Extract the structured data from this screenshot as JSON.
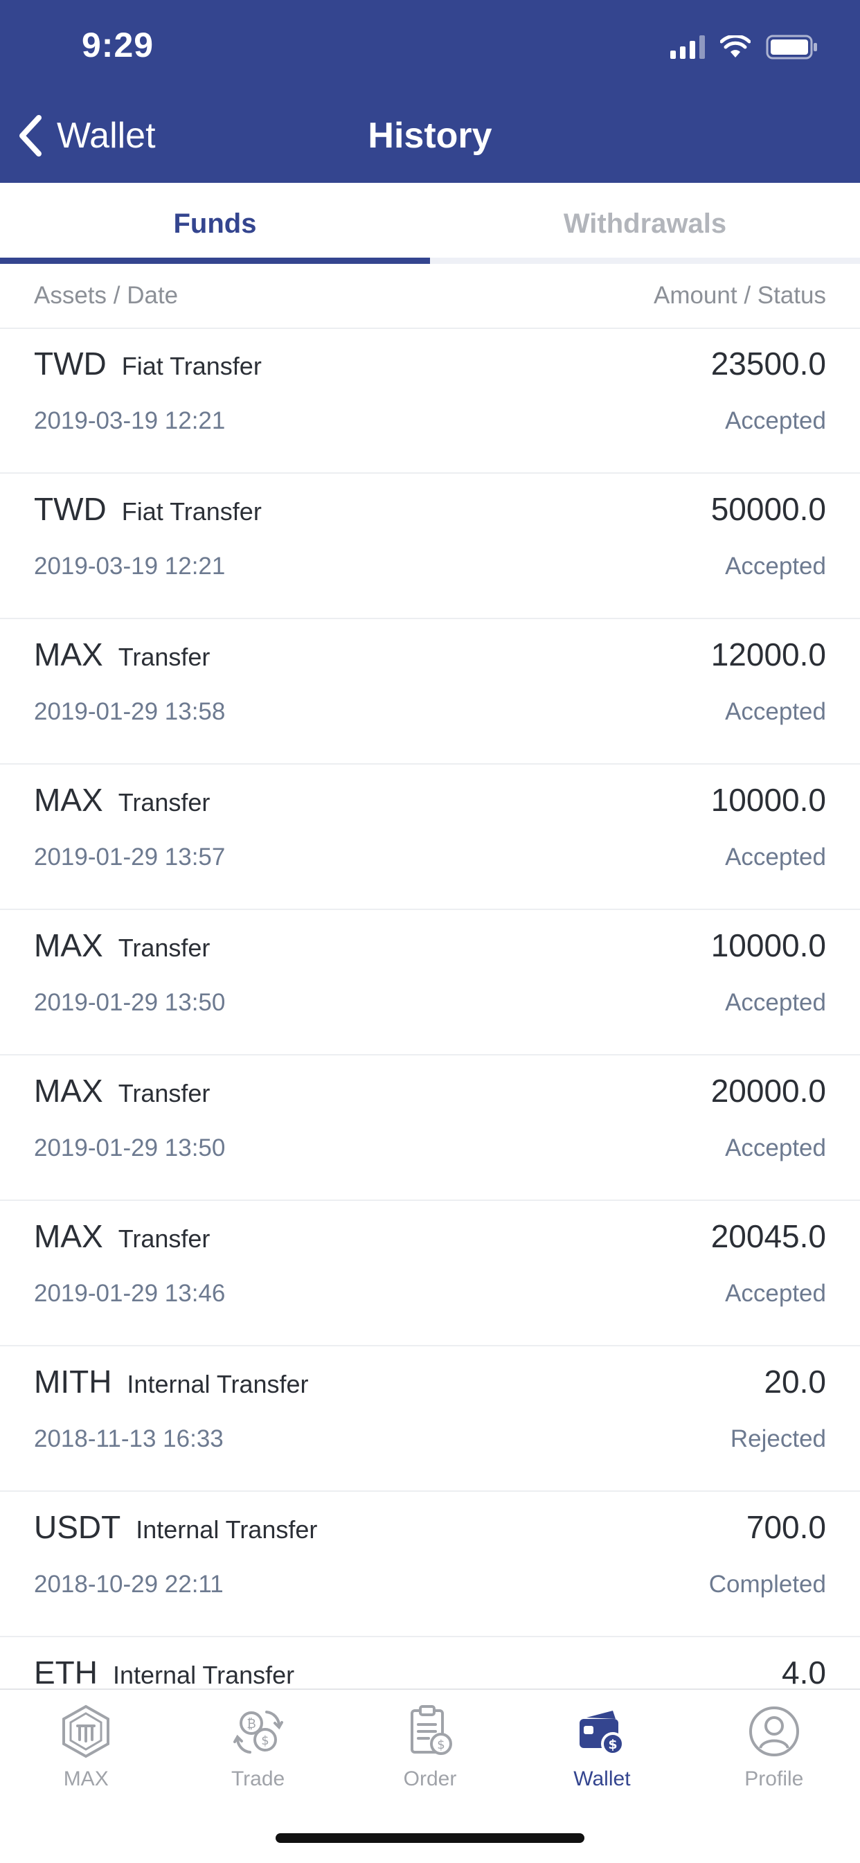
{
  "status_bar": {
    "time": "9:29"
  },
  "nav": {
    "back_label": "Wallet",
    "title": "History"
  },
  "tabs": [
    {
      "label": "Funds",
      "active": true
    },
    {
      "label": "Withdrawals",
      "active": false
    }
  ],
  "columns": {
    "left": "Assets / Date",
    "right": "Amount / Status"
  },
  "records": [
    {
      "asset": "TWD",
      "kind": "Fiat Transfer",
      "date": "2019-03-19 12:21",
      "amount": "23500.0",
      "status": "Accepted"
    },
    {
      "asset": "TWD",
      "kind": "Fiat Transfer",
      "date": "2019-03-19 12:21",
      "amount": "50000.0",
      "status": "Accepted"
    },
    {
      "asset": "MAX",
      "kind": "Transfer",
      "date": "2019-01-29 13:58",
      "amount": "12000.0",
      "status": "Accepted"
    },
    {
      "asset": "MAX",
      "kind": "Transfer",
      "date": "2019-01-29 13:57",
      "amount": "10000.0",
      "status": "Accepted"
    },
    {
      "asset": "MAX",
      "kind": "Transfer",
      "date": "2019-01-29 13:50",
      "amount": "10000.0",
      "status": "Accepted"
    },
    {
      "asset": "MAX",
      "kind": "Transfer",
      "date": "2019-01-29 13:50",
      "amount": "20000.0",
      "status": "Accepted"
    },
    {
      "asset": "MAX",
      "kind": "Transfer",
      "date": "2019-01-29 13:46",
      "amount": "20045.0",
      "status": "Accepted"
    },
    {
      "asset": "MITH",
      "kind": "Internal Transfer",
      "date": "2018-11-13 16:33",
      "amount": "20.0",
      "status": "Rejected"
    },
    {
      "asset": "USDT",
      "kind": "Internal Transfer",
      "date": "2018-10-29 22:11",
      "amount": "700.0",
      "status": "Completed"
    },
    {
      "asset": "ETH",
      "kind": "Internal Transfer",
      "date": "",
      "amount": "4.0",
      "status": ""
    }
  ],
  "tabbar": [
    {
      "label": "MAX",
      "icon": "max-logo-icon",
      "active": false
    },
    {
      "label": "Trade",
      "icon": "trade-icon",
      "active": false
    },
    {
      "label": "Order",
      "icon": "order-icon",
      "active": false
    },
    {
      "label": "Wallet",
      "icon": "wallet-icon",
      "active": true
    },
    {
      "label": "Profile",
      "icon": "profile-icon",
      "active": false
    }
  ],
  "colors": {
    "brand": "#34458f",
    "inactive": "#a0a3a9",
    "secondary_text": "#6d7a90"
  }
}
